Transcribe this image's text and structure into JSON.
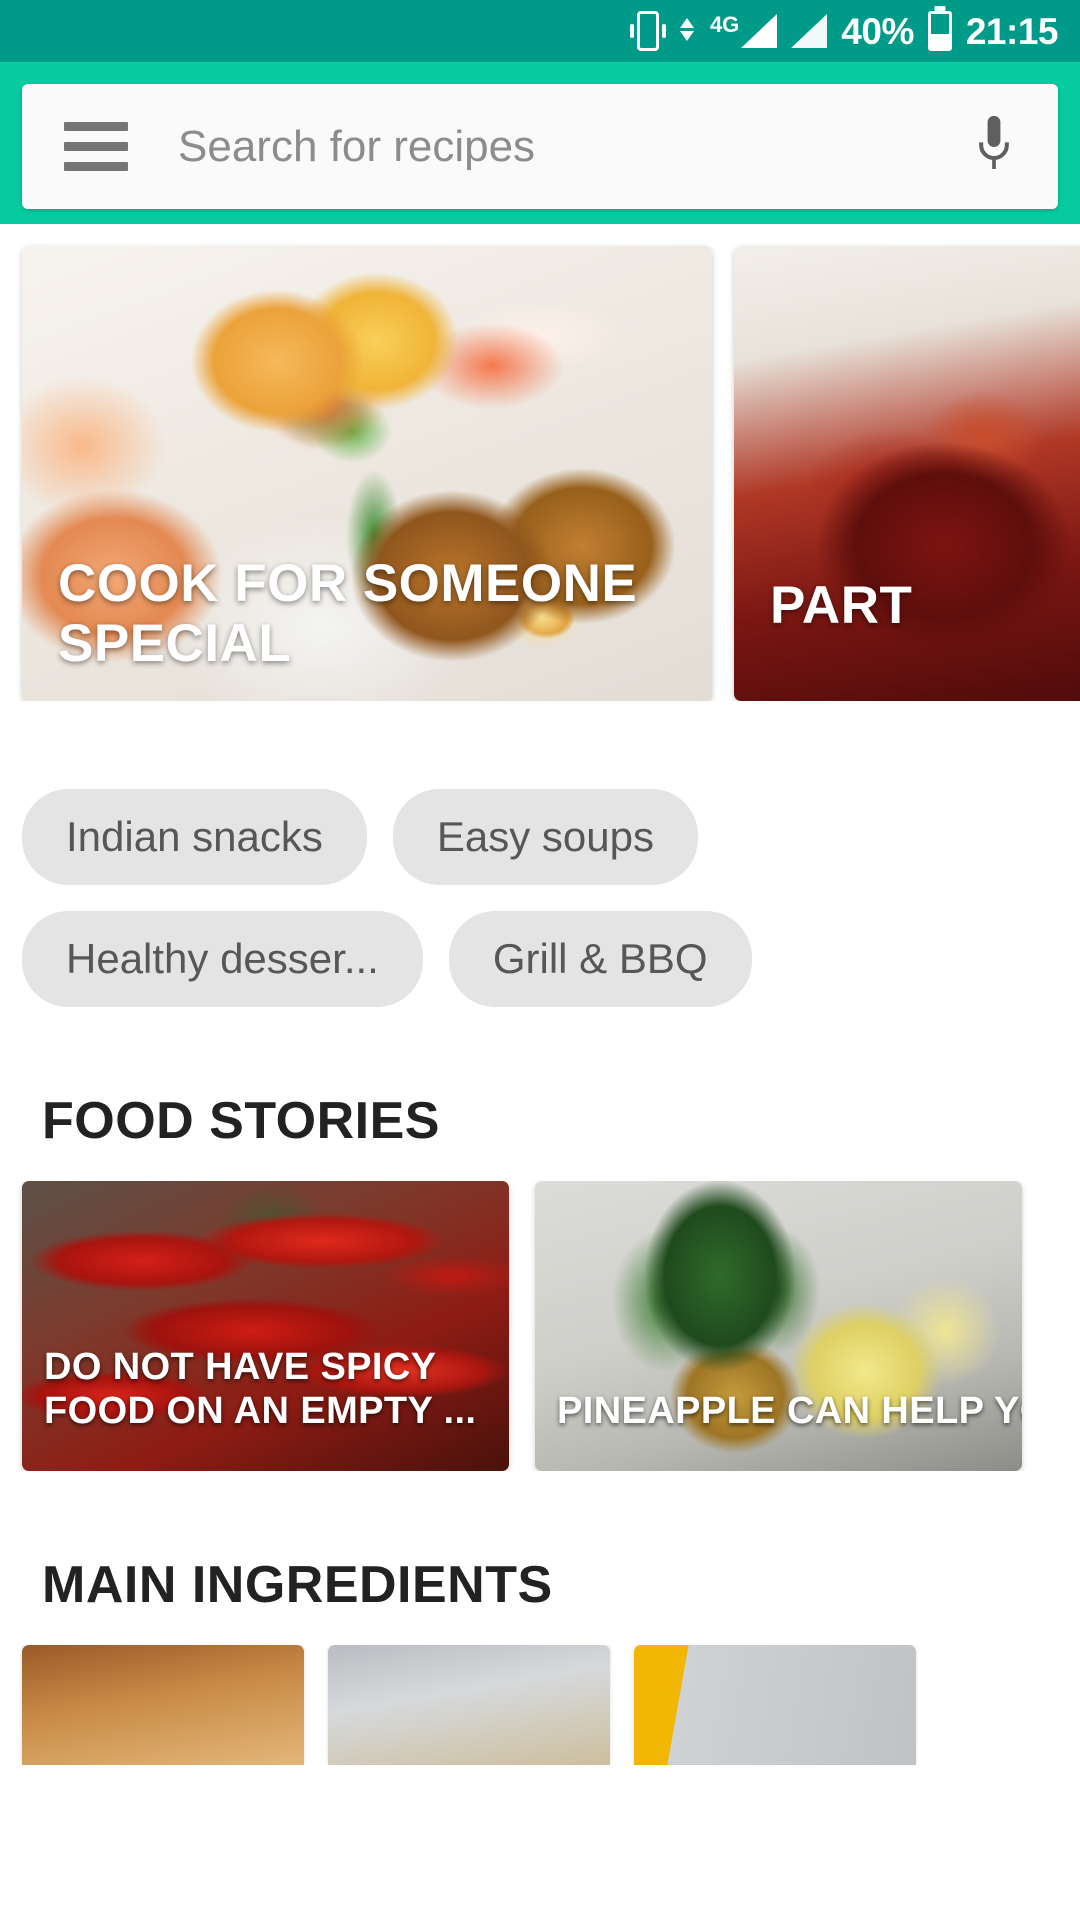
{
  "status_bar": {
    "network_type": "4G",
    "battery_percent": "40%",
    "time": "21:15",
    "icons": [
      "vibrate-icon",
      "data-transfer-icon",
      "signal-icon-1",
      "signal-icon-2",
      "battery-icon"
    ]
  },
  "header": {
    "menu_icon": "hamburger-menu-icon",
    "search_placeholder": "Search for recipes",
    "search_value": "",
    "mic_icon": "microphone-icon",
    "accent_color": "#07cba1",
    "status_bar_color": "#009b88"
  },
  "hero_carousel": {
    "cards": [
      {
        "title": "Cook for someone special"
      },
      {
        "title": "Part"
      }
    ]
  },
  "chips": [
    {
      "label": "Indian snacks"
    },
    {
      "label": "Easy soups"
    },
    {
      "label": "Healthy desser..."
    },
    {
      "label": "Grill & BBQ"
    }
  ],
  "food_stories": {
    "heading": "Food Stories",
    "cards": [
      {
        "title": "Do not have spicy food on an empty ..."
      },
      {
        "title": "Pineapple can help you burn fat"
      }
    ]
  },
  "main_ingredients": {
    "heading": "Main Ingredients",
    "cards": [
      {
        "label": ""
      },
      {
        "label": ""
      },
      {
        "label": ""
      }
    ]
  }
}
